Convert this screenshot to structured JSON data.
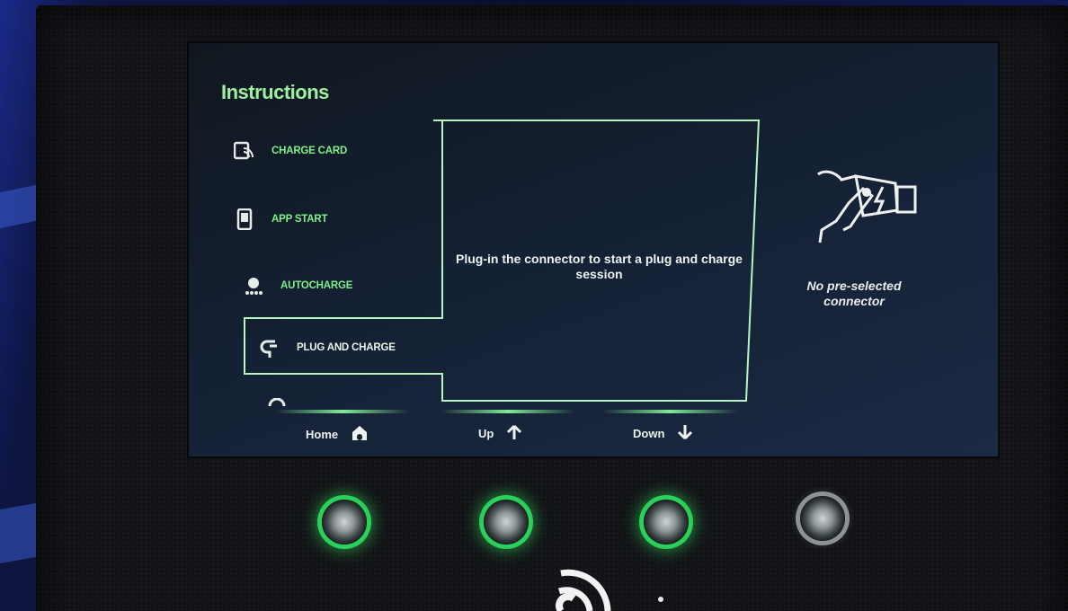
{
  "screen": {
    "title": "Instructions",
    "menu": [
      {
        "label": "CHARGE CARD",
        "icon": "charge-card-icon"
      },
      {
        "label": "APP START",
        "icon": "phone-icon"
      },
      {
        "label": "AUTOCHARGE",
        "icon": "autocharge-icon"
      },
      {
        "label": "PLUG AND CHARGE",
        "icon": "plug-icon",
        "selected": true
      },
      {
        "label": "",
        "icon": "partial-icon"
      }
    ],
    "center_message": "Plug-in the connector to start a plug and charge session",
    "connector_status": "No pre-selected connector",
    "nav": {
      "home_label": "Home",
      "up_label": "Up",
      "down_label": "Down"
    }
  },
  "colors": {
    "accent_green": "#7ff08a",
    "screen_bg": "#142033",
    "panel_bg": "#121316"
  }
}
